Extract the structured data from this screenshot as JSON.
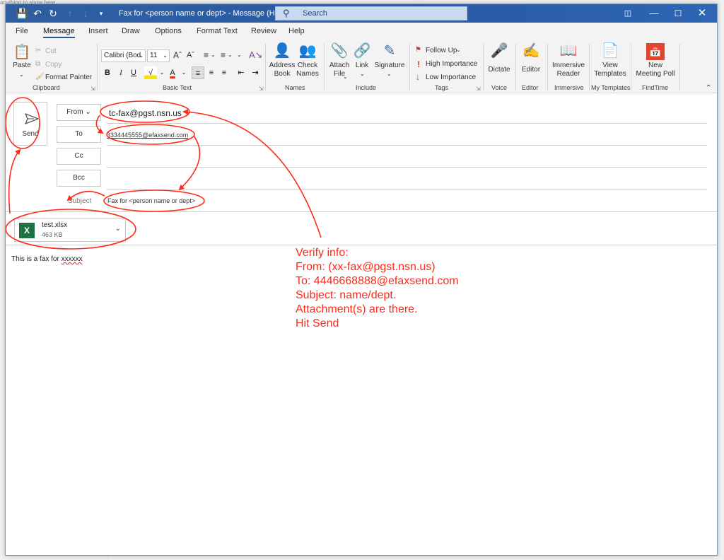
{
  "bg": {
    "text": "anything to show here."
  },
  "titlebar": {
    "title": "Fax for <person name or dept>  -  Message (HTML)",
    "search_placeholder": "Search",
    "icons": [
      "save-icon",
      "undo-icon",
      "redo-icon",
      "up-arrow-icon",
      "down-arrow-icon",
      "customize-icon",
      "display-options-icon",
      "minimize-icon",
      "maximize-icon",
      "close-icon"
    ]
  },
  "tabs": [
    "File",
    "Message",
    "Insert",
    "Draw",
    "Options",
    "Format Text",
    "Review",
    "Help"
  ],
  "ribbon": {
    "clipboard": {
      "paste": "Paste",
      "cut": "Cut",
      "copy": "Copy",
      "format_painter": "Format Painter",
      "label": "Clipboard"
    },
    "basic_text": {
      "font": "Calibri (Bod",
      "size": "11",
      "label": "Basic Text"
    },
    "names": {
      "address_book": "Address\nBook",
      "check_names": "Check\nNames",
      "label": "Names"
    },
    "include": {
      "attach_file": "Attach\nFile",
      "link": "Link",
      "signature": "Signature",
      "label": "Include"
    },
    "tags": {
      "follow_up": "Follow Up",
      "high_importance": "High Importance",
      "low_importance": "Low Importance",
      "label": "Tags"
    },
    "voice": {
      "dictate": "Dictate",
      "label": "Voice"
    },
    "editor": {
      "editor": "Editor",
      "label": "Editor"
    },
    "immersive": {
      "reader": "Immersive\nReader",
      "label": "Immersive"
    },
    "templates": {
      "view": "View\nTemplates",
      "label": "My Templates"
    },
    "findtime": {
      "poll": "New\nMeeting Poll",
      "label": "FindTime"
    }
  },
  "compose": {
    "send": "Send",
    "from_label": "From",
    "from_value": "tc-fax@pgst.nsn.us",
    "to_label": "To",
    "to_value": "3334445555@efaxsend.com",
    "cc_label": "Cc",
    "bcc_label": "Bcc",
    "subject_label": "Subject",
    "subject_value": "Fax for <person name or dept>",
    "attachment": {
      "name": "test.xlsx",
      "size": "463 KB"
    },
    "body_prefix": "This is a fax for ",
    "body_word": "xxxxxx"
  },
  "annotation": {
    "lines": [
      "Verify info:",
      "From: (xx-fax@pgst.nsn.us)",
      "To: 4446668888@efaxsend.com",
      "Subject: name/dept.",
      "Attachment(s) are there.",
      "Hit Send"
    ],
    "color": "#ff2a1a"
  }
}
